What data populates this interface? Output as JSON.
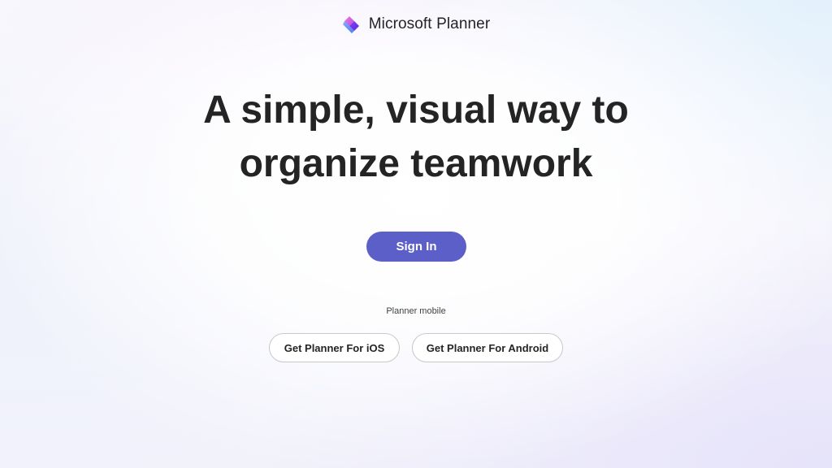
{
  "header": {
    "brand_name": "Microsoft Planner",
    "logo_icon": "microsoft-planner-logo"
  },
  "hero": {
    "headline_line1": "A simple, visual way to",
    "headline_line2": "organize teamwork"
  },
  "actions": {
    "sign_in_label": "Sign In"
  },
  "mobile": {
    "section_label": "Planner mobile",
    "ios_label": "Get Planner For iOS",
    "android_label": "Get Planner For Android"
  },
  "colors": {
    "primary": "#5b5fc7",
    "text": "#242424",
    "button_border": "#c8c8c8"
  }
}
